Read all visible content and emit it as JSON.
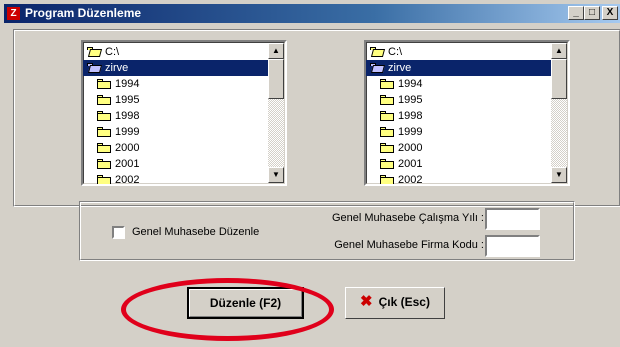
{
  "window": {
    "title": "Program Düzenleme",
    "app_icon": "Z"
  },
  "title_buttons": {
    "minimize": "_",
    "maximize": "□",
    "close": "X"
  },
  "left_dirlist": {
    "items": [
      {
        "label": "C:\\",
        "icon": "open-folder-icon",
        "selected": false,
        "indent": 1
      },
      {
        "label": "zirve",
        "icon": "open-folder-icon",
        "selected": true,
        "indent": 1
      },
      {
        "label": "1994",
        "icon": "folder-icon",
        "selected": false,
        "indent": 2
      },
      {
        "label": "1995",
        "icon": "folder-icon",
        "selected": false,
        "indent": 2
      },
      {
        "label": "1998",
        "icon": "folder-icon",
        "selected": false,
        "indent": 2
      },
      {
        "label": "1999",
        "icon": "folder-icon",
        "selected": false,
        "indent": 2
      },
      {
        "label": "2000",
        "icon": "folder-icon",
        "selected": false,
        "indent": 2
      },
      {
        "label": "2001",
        "icon": "folder-icon",
        "selected": false,
        "indent": 2
      },
      {
        "label": "2002",
        "icon": "folder-icon",
        "selected": false,
        "indent": 2
      }
    ]
  },
  "right_dirlist": {
    "items": [
      {
        "label": "C:\\",
        "icon": "open-folder-icon",
        "selected": false,
        "indent": 1
      },
      {
        "label": "zirve",
        "icon": "open-folder-icon",
        "selected": true,
        "indent": 1
      },
      {
        "label": "1994",
        "icon": "folder-icon",
        "selected": false,
        "indent": 2
      },
      {
        "label": "1995",
        "icon": "folder-icon",
        "selected": false,
        "indent": 2
      },
      {
        "label": "1998",
        "icon": "folder-icon",
        "selected": false,
        "indent": 2
      },
      {
        "label": "1999",
        "icon": "folder-icon",
        "selected": false,
        "indent": 2
      },
      {
        "label": "2000",
        "icon": "folder-icon",
        "selected": false,
        "indent": 2
      },
      {
        "label": "2001",
        "icon": "folder-icon",
        "selected": false,
        "indent": 2
      },
      {
        "label": "2002",
        "icon": "folder-icon",
        "selected": false,
        "indent": 2
      }
    ]
  },
  "options": {
    "checkbox_label": "Genel Muhasebe Düzenle",
    "checkbox_checked": false,
    "year_label": "Genel Muhasebe Çalışma Yılı :",
    "year_value": "",
    "firm_label": "Genel Muhasebe Firma Kodu :",
    "firm_value": ""
  },
  "buttons": {
    "edit_label": "Düzenle (F2)",
    "exit_label": "Çık (Esc)"
  },
  "colors": {
    "selection": "#0a246a",
    "face": "#d4d0c8",
    "highlight_oval": "#e0001b"
  }
}
